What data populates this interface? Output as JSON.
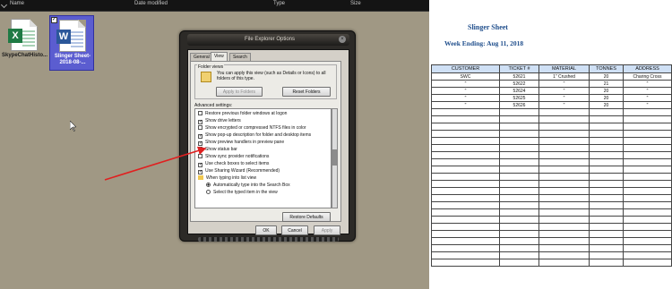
{
  "explorer": {
    "columns": {
      "name": "Name",
      "date_modified": "Date modified",
      "type": "Type",
      "size": "Size"
    },
    "files": [
      {
        "label": "SkypeChatHisto...",
        "icon": "excel-icon",
        "tile": "X"
      },
      {
        "label": "Slinger Sheet-2018-08-...",
        "icon": "word-icon",
        "tile": "W"
      }
    ]
  },
  "dialog": {
    "title": "File Explorer Options",
    "close_glyph": "×",
    "tabs": [
      "General",
      "View",
      "Search"
    ],
    "folder_views": {
      "title": "Folder views",
      "description": "You can apply this view (such as Details or Icons) to all folders of this type.",
      "apply_button": "Apply to Folders",
      "reset_button": "Reset Folders"
    },
    "advanced_label": "Advanced settings:",
    "options": [
      {
        "label": "Restore previous folder windows at logon",
        "kind": "checkbox",
        "checked": false
      },
      {
        "label": "Show drive letters",
        "kind": "checkbox",
        "checked": true
      },
      {
        "label": "Show encrypted or compressed NTFS files in color",
        "kind": "checkbox",
        "checked": false
      },
      {
        "label": "Show pop-up description for folder and desktop items",
        "kind": "checkbox",
        "checked": true
      },
      {
        "label": "Show preview handlers in preview pane",
        "kind": "checkbox",
        "checked": true
      },
      {
        "label": "Show status bar",
        "kind": "checkbox",
        "checked": false
      },
      {
        "label": "Show sync provider notifications",
        "kind": "checkbox",
        "checked": false
      },
      {
        "label": "Use check boxes to select items",
        "kind": "checkbox",
        "checked": true
      },
      {
        "label": "Use Sharing Wizard (Recommended)",
        "kind": "checkbox",
        "checked": true
      },
      {
        "label": "When typing into list view",
        "kind": "folder",
        "checked": false
      },
      {
        "label": "Automatically type into the Search Box",
        "kind": "radio",
        "checked": true
      },
      {
        "label": "Select the typed item in the view",
        "kind": "radio",
        "checked": false
      }
    ],
    "restore_defaults": "Restore Defaults",
    "ok": "OK",
    "cancel": "Cancel",
    "apply": "Apply"
  },
  "sheet": {
    "title": "Slinger Sheet",
    "week_ending": "Week Ending: Aug 11, 2018",
    "headers": [
      "CUSTOMER",
      "TICKET #",
      "MATERIAL",
      "TONNES",
      "ADDRESS"
    ],
    "rows": [
      [
        "SWC",
        "52621",
        "1\" Crushed",
        "20",
        "Charing Cross"
      ],
      [
        "\"",
        "52622",
        "\"",
        "21",
        "\""
      ],
      [
        "\"",
        "52624",
        "\"",
        "20",
        "\""
      ],
      [
        "\"",
        "52625",
        "\"",
        "20",
        "\""
      ],
      [
        "\"",
        "52626",
        "\"",
        "20",
        "\""
      ]
    ],
    "empty_rows": 22
  },
  "colors": {
    "arrow": "#e02020",
    "sheet_header_bg": "#cfe0f5",
    "sheet_title": "#1f4e8c",
    "desktop_bg": "#a09884"
  }
}
